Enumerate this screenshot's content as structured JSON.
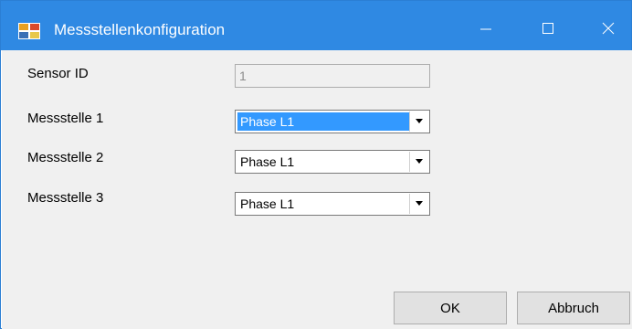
{
  "window": {
    "title": "Messstellenkonfiguration",
    "minimize_icon": "minimize-icon",
    "maximize_icon": "maximize-icon",
    "close_icon": "close-icon"
  },
  "form": {
    "sensor_id": {
      "label": "Sensor ID",
      "value": "1"
    },
    "messstellen": [
      {
        "label": "Messstelle 1",
        "value": "Phase L1"
      },
      {
        "label": "Messstelle 2",
        "value": "Phase L1"
      },
      {
        "label": "Messstelle 3",
        "value": "Phase L1"
      }
    ]
  },
  "buttons": {
    "ok": "OK",
    "cancel": "Abbruch"
  },
  "colors": {
    "titlebar": "#2f89e3",
    "selection": "#3399ff",
    "client_bg": "#f0f0f0"
  }
}
